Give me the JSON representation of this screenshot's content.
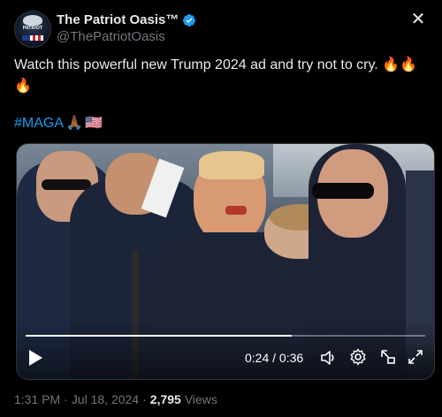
{
  "account": {
    "display_name": "The Patriot Oasis™",
    "handle": "@ThePatriotOasis",
    "avatar_text": "PATRIOT",
    "verified": true
  },
  "tweet": {
    "text": "Watch this powerful new Trump 2024 ad and try not to cry. 🔥🔥🔥",
    "hashtag": "#MAGA",
    "trailing_emojis": [
      "🙏🏾",
      "🇺🇸"
    ]
  },
  "video": {
    "current_time": "0:24",
    "duration": "0:36",
    "time_display": "0:24 / 0:36",
    "progress_fraction": 0.6667
  },
  "meta": {
    "time": "1:31 PM",
    "date": "Jul 18, 2024",
    "views_count": "2,795",
    "views_label": "Views",
    "separator": "·"
  },
  "icons": {
    "close": "close-icon",
    "verified": "verified-badge-icon",
    "play": "play-icon",
    "volume": "volume-icon",
    "settings": "gear-icon",
    "pip": "picture-in-picture-icon",
    "fullscreen": "expand-icon"
  },
  "colors": {
    "background": "#000000",
    "text": "#e7e9ea",
    "muted": "#71767b",
    "link": "#1d9bf0",
    "verified": "#1d9bf0"
  }
}
